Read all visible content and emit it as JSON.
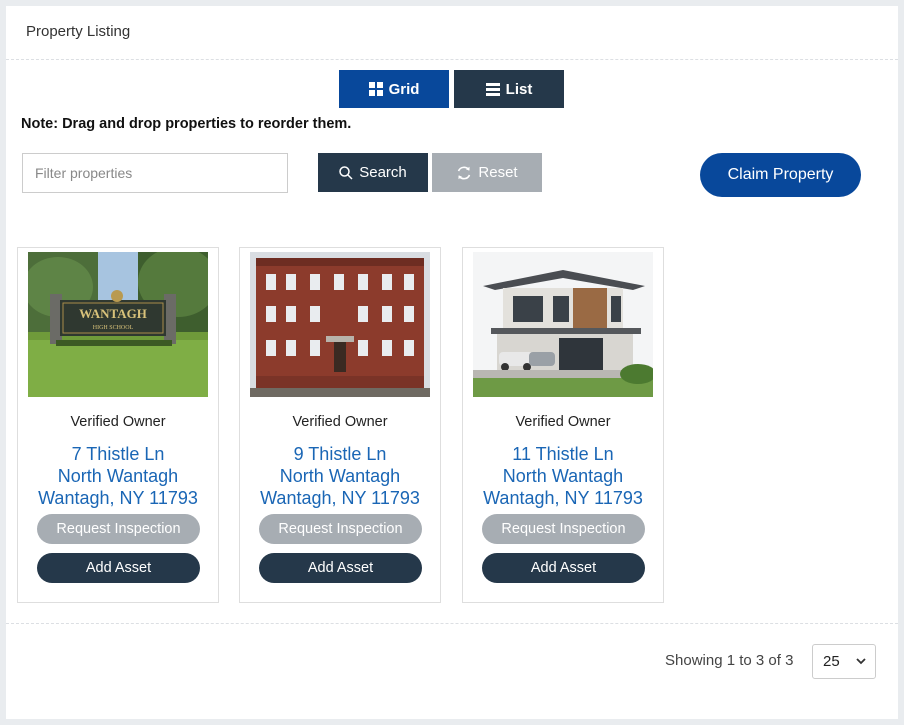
{
  "panel": {
    "title": "Property Listing"
  },
  "view_toggle": {
    "grid_label": "Grid",
    "list_label": "List"
  },
  "note": "Note: Drag and drop properties to reorder them.",
  "filter": {
    "placeholder": "Filter properties",
    "value": ""
  },
  "actions": {
    "search_label": "Search",
    "reset_label": "Reset",
    "claim_label": "Claim Property"
  },
  "properties": [
    {
      "owner_status": "Verified Owner",
      "street": "7 Thistle Ln",
      "area": "North Wantagh",
      "city_line": "Wantagh, NY 11793",
      "image_sign_text": "WANTAGH",
      "image_sign_subtext": "HIGH SCHOOL",
      "inspect_label": "Request Inspection",
      "asset_label": "Add Asset"
    },
    {
      "owner_status": "Verified Owner",
      "street": "9 Thistle Ln",
      "area": "North Wantagh",
      "city_line": "Wantagh, NY 11793",
      "inspect_label": "Request Inspection",
      "asset_label": "Add Asset"
    },
    {
      "owner_status": "Verified Owner",
      "street": "11 Thistle Ln",
      "area": "North Wantagh",
      "city_line": "Wantagh, NY 11793",
      "inspect_label": "Request Inspection",
      "asset_label": "Add Asset"
    }
  ],
  "pagination": {
    "summary": "Showing 1 to 3 of 3",
    "page_size": "25"
  },
  "colors": {
    "primary": "#08489b",
    "dark": "#25384a",
    "muted": "#a7adb3",
    "link": "#1a66b5"
  },
  "icons": {
    "grid": "grid-icon",
    "list": "list-icon",
    "search": "search-icon",
    "reset": "refresh-icon",
    "select": "chevron-down-icon"
  }
}
